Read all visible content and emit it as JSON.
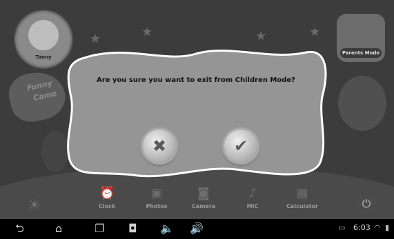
{
  "profile": {
    "name": "Tanny"
  },
  "funny_sign": {
    "line1": "Funny",
    "line2": "Came"
  },
  "parents_mode": {
    "label": "Parents Mode"
  },
  "dialog": {
    "message": "Are you sure you want to exit from Children Mode?",
    "cancel_icon": "close-icon",
    "confirm_icon": "checkmark-icon"
  },
  "bottom_bar": {
    "items": [
      {
        "label": "Clock",
        "icon": "clock-icon"
      },
      {
        "label": "Photos",
        "icon": "photos-icon"
      },
      {
        "label": "Camera",
        "icon": "camera-icon"
      },
      {
        "label": "MIC",
        "icon": "microphone-icon"
      },
      {
        "label": "Calculator",
        "icon": "calculator-icon"
      }
    ],
    "brightness_icon": "sun-icon",
    "power_icon": "power-icon"
  },
  "system_bar": {
    "time": "6:03",
    "nav_icons": [
      "back-icon",
      "home-icon",
      "recent-apps-icon",
      "screenshot-icon",
      "volume-down-icon",
      "volume-up-icon"
    ],
    "status_icons": [
      "notification-icon",
      "wifi-icon",
      "battery-icon"
    ]
  }
}
